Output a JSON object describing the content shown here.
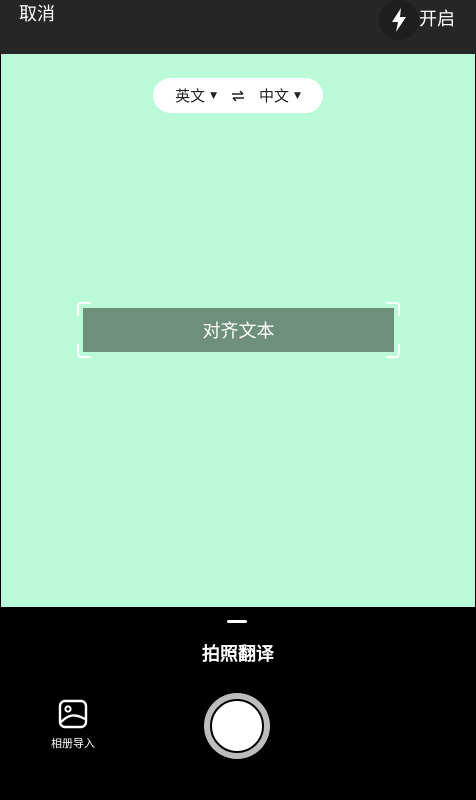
{
  "topbar": {
    "cancel_label": "取消",
    "flash_label": "开启",
    "flash_icon": "lightning-icon"
  },
  "language": {
    "source": "英文",
    "target": "中文",
    "dropdown_icon": "caret-down-icon",
    "swap_icon": "swap-arrows-icon"
  },
  "viewfinder": {
    "background_color": "#bbfad8",
    "align_text": "对齐文本"
  },
  "bottom": {
    "mode_title": "拍照翻译",
    "album_label": "相册导入",
    "album_icon": "image-icon",
    "shutter_icon": "shutter-button"
  }
}
